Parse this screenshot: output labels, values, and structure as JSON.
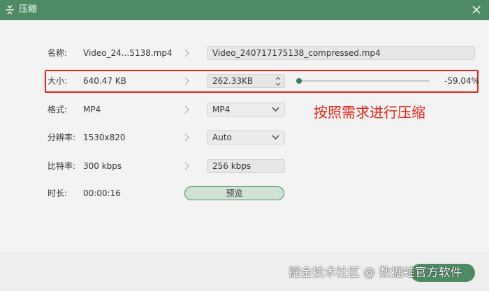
{
  "window": {
    "title": "压缩",
    "title_icon": "compress-icon",
    "close_icon": "close-icon"
  },
  "rows": {
    "name": {
      "label": "名称:",
      "value": "Video_24...5138.mp4",
      "output": "Video_240717175138_compressed.mp4"
    },
    "size": {
      "label": "大小:",
      "value": "640.47 KB",
      "output": "262.33KB",
      "percent": "-59.04%",
      "slider_fraction": 0.0
    },
    "format": {
      "label": "格式:",
      "value": "MP4",
      "selected": "MP4"
    },
    "resolution": {
      "label": "分辨率:",
      "value": "1530x820",
      "selected": "Auto"
    },
    "bitrate": {
      "label": "比特率:",
      "value": "300 kbps",
      "output": "256 kbps"
    },
    "duration": {
      "label": "时长:",
      "value": "00:00:16"
    }
  },
  "preview_button": "预览",
  "annotation": "按照需求进行压缩",
  "watermark": "掘金技术社区 @ 数据蛙官方软件",
  "colors": {
    "accent": "#4e8a63",
    "highlight": "#e0261b"
  }
}
